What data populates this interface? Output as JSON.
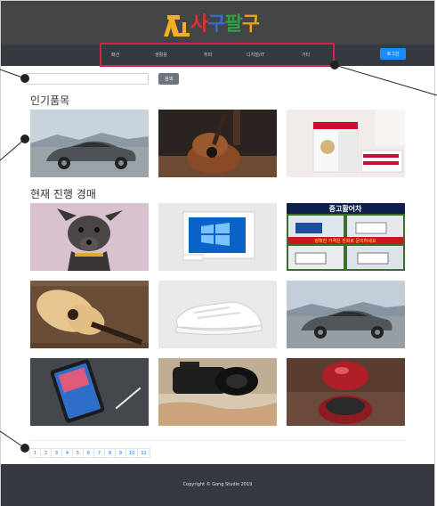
{
  "brand": {
    "name_chars": [
      "사",
      "구",
      "팔",
      "구"
    ]
  },
  "nav": {
    "items": [
      "패션",
      "생활용",
      "취미",
      "디지털/IT",
      "기타"
    ],
    "login_label": "로그인"
  },
  "search": {
    "button_label": "검색",
    "value": ""
  },
  "sections": {
    "popular_title": "인기품목",
    "auction_title": "현재 진행 경매"
  },
  "popular_items": [
    "car-sedan",
    "acoustic-guitar",
    "gift-box"
  ],
  "auction_items": [
    "dog",
    "windows-software",
    "used-trucks-poster",
    "guitar",
    "sneakers",
    "car-sedan",
    "tablet",
    "camera",
    "rice-cooker"
  ],
  "poster": {
    "title": "중고활어차",
    "subtitle": "정확한 가격은 전화로 문의하세요"
  },
  "pagination": [
    "1",
    "2",
    "3",
    "4",
    "5",
    "6",
    "7",
    "8",
    "9",
    "10",
    "11"
  ],
  "footer": {
    "copyright": "Copyright © Gong Studio 2019"
  },
  "colors": {
    "header_bg": "#444546",
    "nav_bg": "#343a40",
    "highlight": "#d4224a",
    "login": "#1a8cff"
  }
}
